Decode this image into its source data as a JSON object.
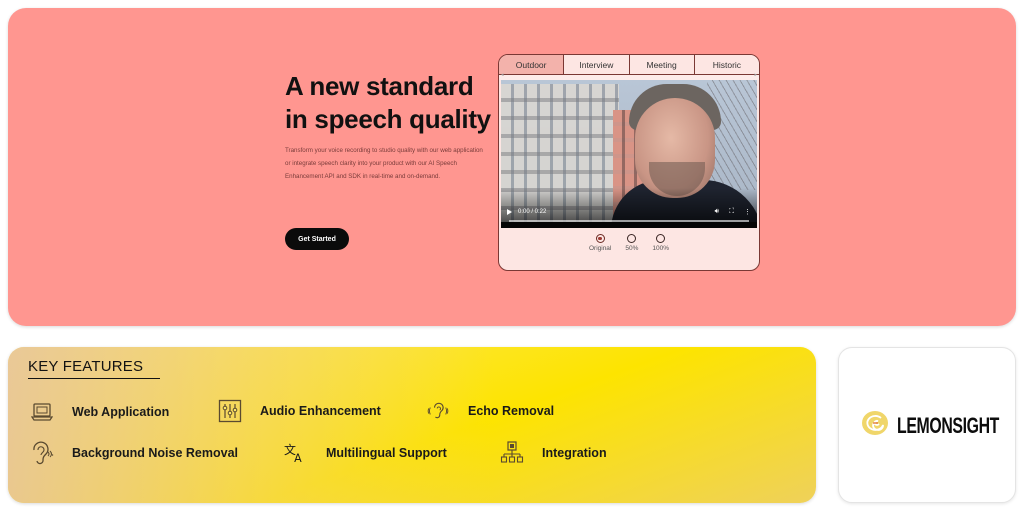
{
  "hero": {
    "title": "A new standard in speech quality",
    "description": "Transform your voice recording to studio quality with our web application or integrate speech clarity into your product with our AI Speech Enhancement API and SDK in real-time and on-demand.",
    "cta_label": "Get Started",
    "background_color": "#ff9690"
  },
  "player": {
    "tabs": [
      {
        "label": "Outdoor",
        "active": true
      },
      {
        "label": "Interview",
        "active": false
      },
      {
        "label": "Meeting",
        "active": false
      },
      {
        "label": "Historic",
        "active": false
      }
    ],
    "video": {
      "time": "0:00 / 0:22",
      "progress": 0,
      "icons": [
        "play-icon",
        "volume-icon",
        "fullscreen-icon",
        "more-options-icon"
      ]
    },
    "enhancement_options": [
      {
        "label": "Original",
        "selected": true
      },
      {
        "label": "50%",
        "selected": false
      },
      {
        "label": "100%",
        "selected": false
      }
    ]
  },
  "features": {
    "title": "KEY FEATURES",
    "items": [
      {
        "label": "Web Application",
        "icon": "laptop-icon"
      },
      {
        "label": "Audio Enhancement",
        "icon": "equalizer-sliders-icon"
      },
      {
        "label": "Echo Removal",
        "icon": "ear-sound-icon"
      },
      {
        "label": "Background Noise Removal",
        "icon": "ear-noise-icon"
      },
      {
        "label": "Multilingual Support",
        "icon": "translate-icon"
      },
      {
        "label": "Integration",
        "icon": "network-hierarchy-icon"
      }
    ]
  },
  "partner": {
    "logo_text": "LEMONSIGHT",
    "logo_icon": "lemon-spiral-icon",
    "logo_color": "#f0d66a"
  }
}
